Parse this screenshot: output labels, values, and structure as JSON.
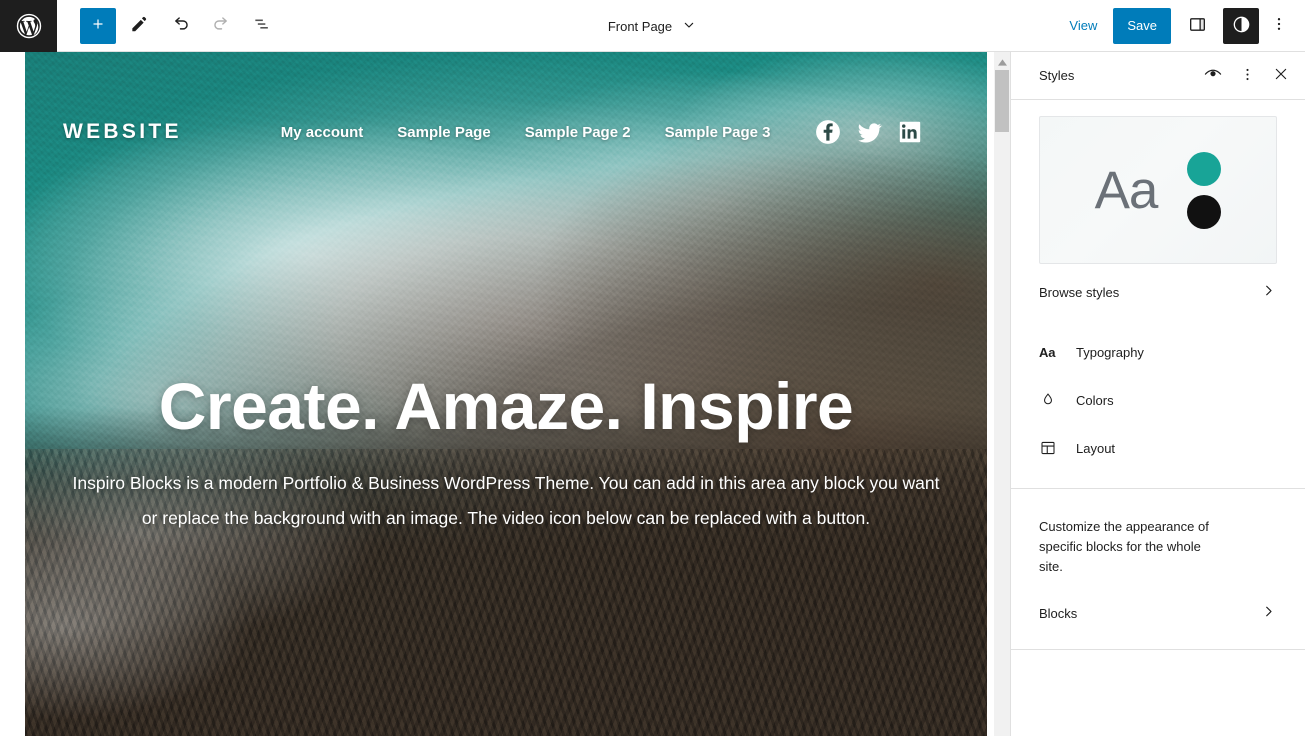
{
  "topbar": {
    "logo_icon": "wordpress-logo-icon",
    "add_block_icon": "plus-icon",
    "tools_icon": "pencil-icon",
    "undo_icon": "undo-icon",
    "redo_icon": "redo-icon",
    "list_view_icon": "list-view-icon",
    "document_title": "Front Page",
    "document_chevron_icon": "chevron-down-icon",
    "view_label": "View",
    "save_label": "Save",
    "sidebar_toggle_icon": "sidebar-panel-icon",
    "styles_toggle_icon": "styles-contrast-icon",
    "options_icon": "more-vertical-icon"
  },
  "canvas": {
    "site_logo": "WEBSITE",
    "nav": [
      {
        "label": "My account"
      },
      {
        "label": "Sample Page"
      },
      {
        "label": "Sample Page 2"
      },
      {
        "label": "Sample Page 3"
      }
    ],
    "social": [
      {
        "name": "facebook-icon"
      },
      {
        "name": "twitter-icon"
      },
      {
        "name": "linkedin-icon"
      }
    ],
    "hero_title": "Create. Amaze. Inspire",
    "hero_paragraph": "Inspiro Blocks is a modern Portfolio & Business WordPress Theme. You can add in this area any block you want or replace the background with an image. The video icon below can be replaced with a button."
  },
  "sidebar": {
    "title": "Styles",
    "header_actions": [
      {
        "name": "style-book-eye-icon"
      },
      {
        "name": "more-vertical-icon"
      },
      {
        "name": "close-icon"
      }
    ],
    "preview": {
      "sample_text": "Aa",
      "accent_color": "#18a497",
      "contrast_color": "#111111"
    },
    "browse_styles": {
      "label": "Browse styles",
      "chevron_icon": "chevron-right-icon"
    },
    "items": [
      {
        "label": "Typography",
        "icon": "typography-aa-icon"
      },
      {
        "label": "Colors",
        "icon": "color-droplet-icon"
      },
      {
        "label": "Layout",
        "icon": "layout-grid-icon"
      }
    ],
    "blocks_description": "Customize the appearance of specific blocks for the whole site.",
    "blocks_row": {
      "label": "Blocks",
      "chevron_icon": "chevron-right-icon"
    }
  },
  "colors": {
    "accent_blue": "#007cba",
    "dark": "#1e1e1e",
    "teal": "#18a497"
  }
}
